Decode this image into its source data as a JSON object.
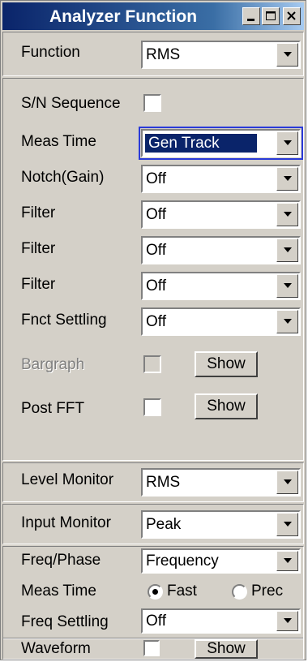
{
  "window": {
    "title": "Analyzer Function"
  },
  "function": {
    "label": "Function",
    "value": "RMS"
  },
  "sn_sequence": {
    "label": "S/N Sequence",
    "checked": false
  },
  "meas_time": {
    "label": "Meas Time",
    "value": "Gen Track"
  },
  "notch": {
    "label": "Notch(Gain)",
    "value": "Off"
  },
  "filters": [
    {
      "label": "Filter",
      "value": "Off"
    },
    {
      "label": "Filter",
      "value": "Off"
    },
    {
      "label": "Filter",
      "value": "Off"
    }
  ],
  "fnct_settling": {
    "label": "Fnct Settling",
    "value": "Off"
  },
  "bargraph": {
    "label": "Bargraph",
    "button": "Show",
    "enabled": false
  },
  "post_fft": {
    "label": "Post FFT",
    "button": "Show"
  },
  "level_monitor": {
    "label": "Level Monitor",
    "value": "RMS"
  },
  "input_monitor": {
    "label": "Input Monitor",
    "value": "Peak"
  },
  "freq_phase": {
    "label": "Freq/Phase",
    "value": "Frequency"
  },
  "freq_meas_time": {
    "label": "Meas Time",
    "options": [
      "Fast",
      "Prec"
    ],
    "selected": "Fast"
  },
  "freq_settling": {
    "label": "Freq Settling",
    "value": "Off"
  },
  "waveform": {
    "label": "Waveform",
    "button": "Show"
  },
  "icons": {
    "dropdown": "chevron-down-icon",
    "minimize": "minimize-icon",
    "maximize": "maximize-icon",
    "close": "close-icon"
  }
}
